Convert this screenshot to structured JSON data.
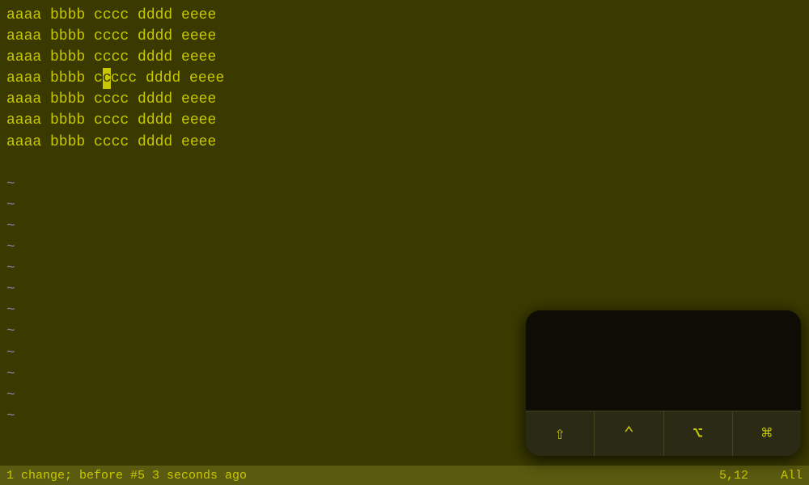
{
  "editor": {
    "lines": [
      "aaaa bbbb cccc dddd eeee",
      "aaaa bbbb cccc dddd eeee",
      "aaaa bbbb cccc dddd eeee",
      "aaaa bbbb c",
      "ccc dddd eeee",
      "aaaa bbbb cccc dddd eeee",
      "aaaa bbbb cccc dddd eeee",
      "aaaa bbbb cccc dddd eeee"
    ],
    "line4_before_cursor": "aaaa bbbb c",
    "line4_cursor": "c",
    "line4_after_cursor": "cc dddd eeee",
    "tilde_count": 12,
    "status": {
      "left": "1 change; before #5  3 seconds ago",
      "position": "5,12",
      "scroll": "All"
    }
  },
  "keyboard": {
    "buttons": [
      {
        "name": "shift",
        "symbol": "⇧"
      },
      {
        "name": "up-arrow",
        "symbol": "^"
      },
      {
        "name": "option",
        "symbol": "⌥"
      },
      {
        "name": "command",
        "symbol": "⌘"
      }
    ]
  }
}
